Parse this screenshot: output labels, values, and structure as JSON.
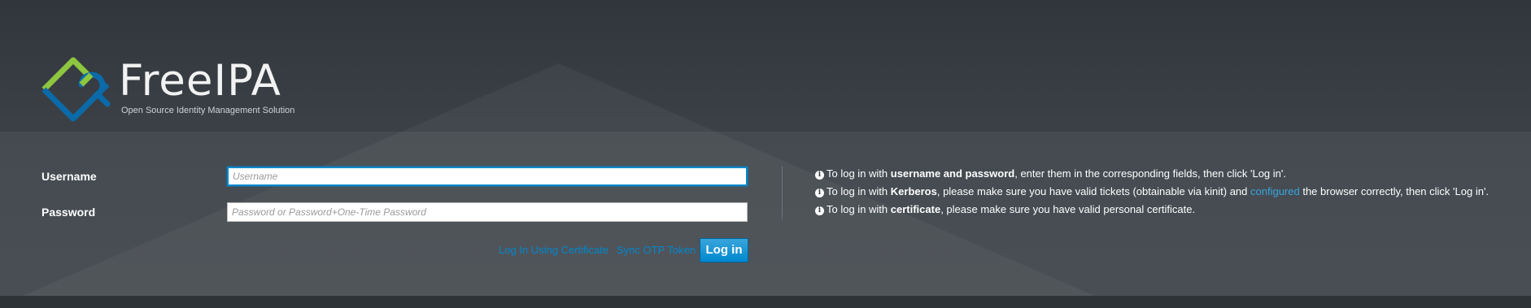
{
  "brand": {
    "name": "FreeIPA",
    "tagline": "Open Source Identity Management Solution",
    "colors": {
      "green": "#8dc63f",
      "blue": "#0b6aa9"
    }
  },
  "form": {
    "username_label": "Username",
    "username_placeholder": "Username",
    "password_label": "Password",
    "password_placeholder": "Password or Password+One-Time Password"
  },
  "actions": {
    "cert_link": "Log In Using Certificate",
    "otp_link": "Sync OTP Token",
    "login_button": "Log in"
  },
  "info": {
    "line1": {
      "pre": "To log in with ",
      "bold": "username and password",
      "post": ", enter them in the corresponding fields, then click 'Log in'."
    },
    "line2": {
      "pre": "To log in with ",
      "bold": "Kerberos",
      "mid": ", please make sure you have valid tickets (obtainable via kinit) and ",
      "link": "configured",
      "post": " the browser correctly, then click 'Log in'."
    },
    "line3": {
      "pre": "To log in with ",
      "bold": "certificate",
      "post": ", please make sure you have valid personal certificate."
    },
    "icon": "info-circle-icon"
  },
  "theme": {
    "accent": "#0088ce",
    "background": "#393f44"
  }
}
